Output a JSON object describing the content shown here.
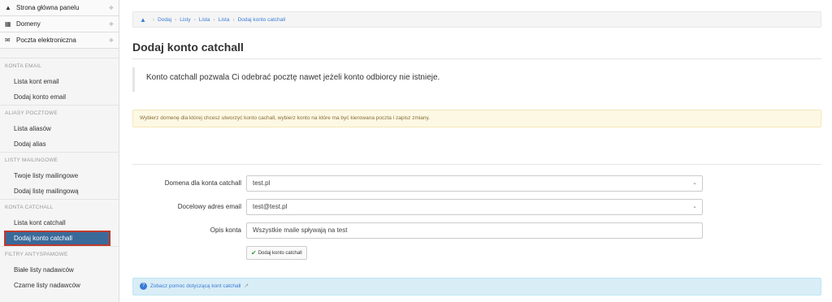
{
  "sidebar": {
    "top_items": [
      {
        "label": "Strona główna panelu",
        "icon": "home-icon"
      },
      {
        "label": "Domeny",
        "icon": "list-icon"
      },
      {
        "label": "Poczta elektroniczna",
        "icon": "envelope-icon"
      }
    ],
    "sections": [
      {
        "header": "KONTA EMAIL",
        "items": [
          "Lista kont email",
          "Dodaj konto email"
        ]
      },
      {
        "header": "ALIASY POCZTOWE",
        "items": [
          "Lista aliasów",
          "Dodaj alias"
        ]
      },
      {
        "header": "LISTY MAILINGOWE",
        "items": [
          "Twoje listy mailingowe",
          "Dodaj listę mailingową"
        ]
      },
      {
        "header": "KONTA CATCHALL",
        "items": [
          "Lista kont catchall",
          "Dodaj konto catchall"
        ]
      },
      {
        "header": "FILTRY ANTYSPAMOWE",
        "items": [
          "Białe listy nadawców",
          "Czarne listy nadawców"
        ]
      }
    ],
    "active_item": "Dodaj konto catchall"
  },
  "breadcrumb": [
    "Dodaj",
    "Listy",
    "Lista",
    "Lista",
    "Dodaj konto catchall"
  ],
  "page_title": "Dodaj konto catchall",
  "description": "Konto catchall pozwala Ci odebrać pocztę nawet jeżeli konto odbiorcy nie istnieje.",
  "warning": "Wybierz domenę dla której chcesz utworzyć konto cachall, wybierz konto na które ma być kierowana poczta i zapisz zmiany.",
  "form": {
    "domain_label": "Domena dla konta catchall",
    "domain_value": "test.pl",
    "target_label": "Docelowy adres email",
    "target_value": "test@test.pl",
    "desc_label": "Opis konta",
    "desc_value": "Wszystkie maile spływają na test",
    "submit_label": "Dodaj konto catchall"
  },
  "help_link": "Zobacz pomoc dotyczącą kont catchall",
  "colors": {
    "accent": "#3a7bd5",
    "active": "#3a6a9a",
    "highlight_border": "#c0392b"
  }
}
